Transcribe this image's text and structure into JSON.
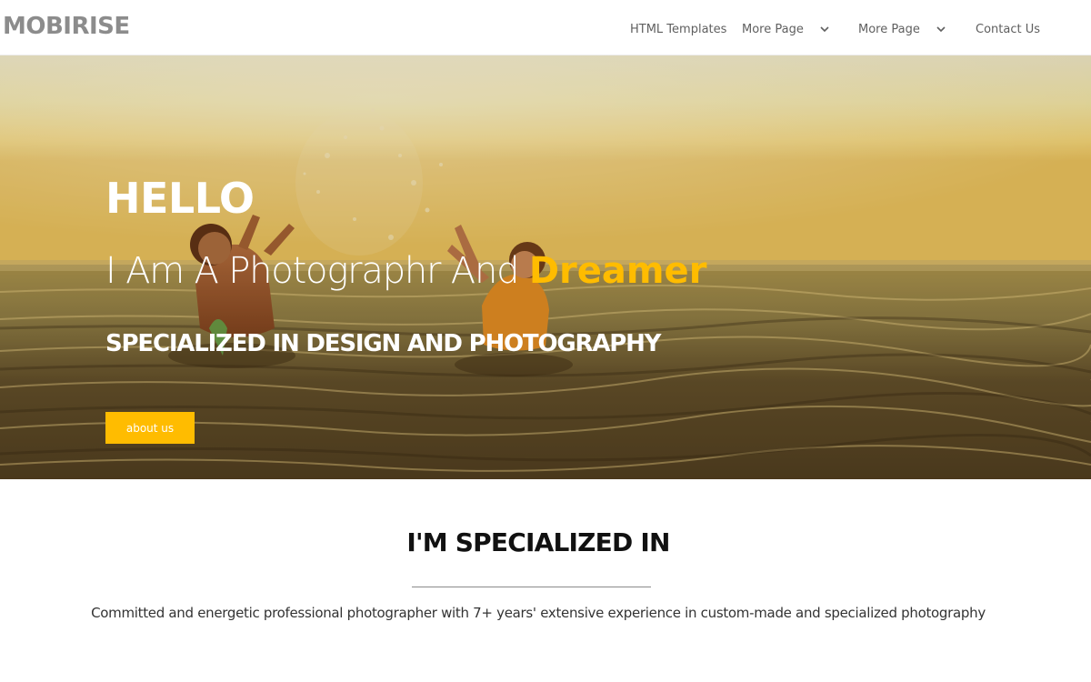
{
  "navbar": {
    "brand": "MOBIRISE",
    "items": [
      {
        "label": "HTML Templates",
        "has_dropdown": false
      },
      {
        "label": "More Page",
        "has_dropdown": true
      },
      {
        "label": "More Page",
        "has_dropdown": true
      },
      {
        "label": "Contact Us",
        "has_dropdown": false
      }
    ],
    "dropdown_icon": "chevron-down-icon"
  },
  "hero": {
    "title": "HELLO",
    "subtitle_prefix": "I Am A Photographr And ",
    "subtitle_accent": "Dreamer",
    "specialization": "SPECIALIZED IN DESIGN AND PHOTOGRAPHY",
    "button_label": "about us",
    "accent_color": "#ffbc00"
  },
  "section": {
    "title": "I'M SPECIALIZED IN",
    "description": "Committed and energetic professional photographer with 7+ years' extensive experience in custom-made and specialized photography"
  }
}
